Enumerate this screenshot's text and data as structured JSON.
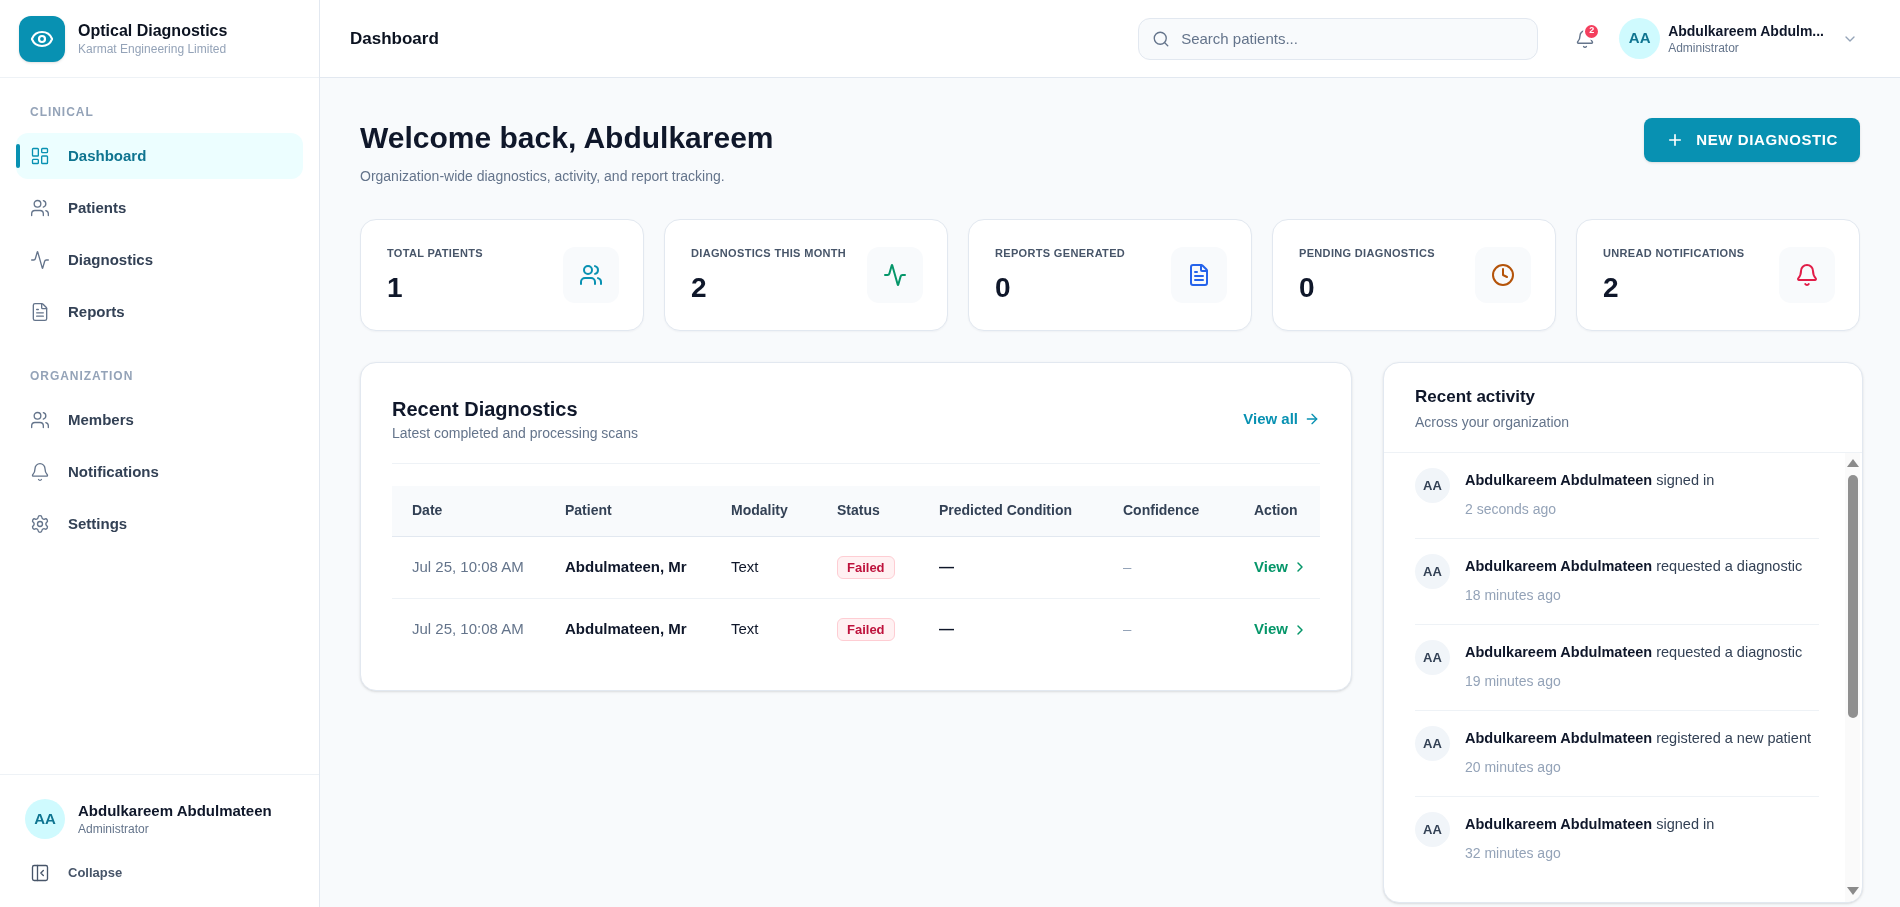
{
  "sidebar": {
    "brand": {
      "title": "Optical Diagnostics",
      "subtitle": "Karmat Engineering Limited"
    },
    "sections": [
      {
        "label": "CLINICAL",
        "items": [
          {
            "label": "Dashboard",
            "selected": true
          },
          {
            "label": "Patients",
            "selected": false
          },
          {
            "label": "Diagnostics",
            "selected": false
          },
          {
            "label": "Reports",
            "selected": false
          }
        ]
      },
      {
        "label": "ORGANIZATION",
        "items": [
          {
            "label": "Members",
            "selected": false
          },
          {
            "label": "Notifications",
            "selected": false
          },
          {
            "label": "Settings",
            "selected": false
          }
        ]
      }
    ],
    "user": {
      "initials": "AA",
      "name": "Abdulkareem Abdulmateen",
      "role": "Administrator"
    },
    "collapse": "Collapse"
  },
  "header": {
    "title": "Dashboard",
    "search": {
      "placeholder": "Search patients..."
    },
    "notifications": {
      "badge": "2"
    },
    "user": {
      "initials": "AA",
      "name": "Abdulkareem Abdulm...",
      "role": "Administrator"
    }
  },
  "welcome": {
    "title": "Welcome back, Abdulkareem",
    "subtitle": "Organization-wide diagnostics, activity, and report tracking.",
    "button": "NEW DIAGNOSTIC"
  },
  "stats": [
    {
      "label": "TOTAL PATIENTS",
      "value": "1",
      "color": "#0891b2"
    },
    {
      "label": "DIAGNOSTICS THIS MONTH",
      "value": "2",
      "color": "#059669"
    },
    {
      "label": "REPORTS GENERATED",
      "value": "0",
      "color": "#2563eb"
    },
    {
      "label": "PENDING DIAGNOSTICS",
      "value": "0",
      "color": "#b45309"
    },
    {
      "label": "UNREAD NOTIFICATIONS",
      "value": "2",
      "color": "#e11d48"
    }
  ],
  "recent_diagnostics": {
    "title": "Recent Diagnostics",
    "subtitle": "Latest completed and processing scans",
    "link": "View all",
    "table": {
      "columns": [
        "Date",
        "Patient",
        "Modality",
        "Status",
        "Predicted Condition",
        "Confidence",
        "Action"
      ],
      "rows": [
        {
          "kind": "failed",
          "date": "Jul 25, 10:08 AM",
          "patient": "Abdulmateen, Mr",
          "modality": "Text",
          "status": "Failed",
          "predicted_condition": "—",
          "confidence": "–",
          "action": "View"
        },
        {
          "kind": "failed",
          "date": "Jul 25, 10:08 AM",
          "patient": "Abdulmateen, Mr",
          "modality": "Text",
          "status": "Failed",
          "predicted_condition": "—",
          "confidence": "–",
          "action": "View"
        }
      ]
    }
  },
  "recent_activity": {
    "title": "Recent activity",
    "subtitle": "Across your organization",
    "items": [
      {
        "initials": "AA",
        "text": "**Abdulkareem Abdulmateen** signed in",
        "time": "2 seconds ago"
      },
      {
        "initials": "AA",
        "text": "**Abdulkareem Abdulmateen** requested a diagnostic",
        "time": "18 minutes ago"
      },
      {
        "initials": "AA",
        "text": "**Abdulkareem Abdulmateen** requested a diagnostic",
        "time": "19 minutes ago"
      },
      {
        "initials": "AA",
        "text": "**Abdulkareem Abdulmateen** registered a new patient",
        "time": "20 minutes ago"
      },
      {
        "initials": "AA",
        "text": "**Abdulkareem Abdulmateen** signed in",
        "time": "32 minutes ago"
      }
    ]
  }
}
